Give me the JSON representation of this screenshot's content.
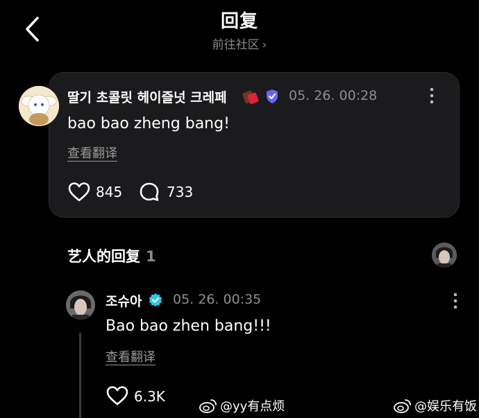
{
  "header": {
    "title": "回复",
    "subtitle": "前往社区",
    "subtitle_chevron": "›"
  },
  "post": {
    "username": "딸기 초콜릿 헤이즐넛 크레페",
    "emoji_icon": "chocolate-bar-icon",
    "badge_icon": "verified-shield-icon",
    "timestamp": "05. 26. 00:28",
    "content": "bao bao zheng bang!",
    "translate_label": "查看翻译",
    "likes": "845",
    "comments": "733"
  },
  "artist_section": {
    "title": "艺人的回复",
    "count": "1"
  },
  "artist_reply": {
    "username": "조슈아",
    "badge_icon": "verified-check-icon",
    "timestamp": "05. 26. 00:35",
    "content": "Bao bao zhen bang!!!",
    "translate_label": "查看翻译",
    "likes": "6.3K"
  },
  "watermarks": [
    {
      "text": "@yy有点烦"
    },
    {
      "text": "@娱乐有饭"
    }
  ],
  "colors": {
    "background": "#000000",
    "card": "#1b1b1d",
    "muted_text": "#8f8f8f",
    "verified_purple": "#6a63f5",
    "verified_teal": "#2ec7e6"
  }
}
